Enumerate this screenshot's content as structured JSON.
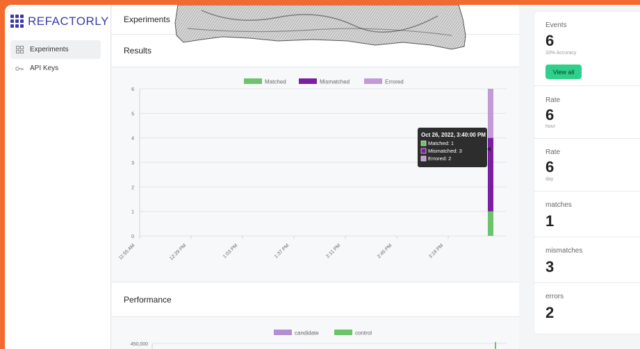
{
  "brand": {
    "name": "REFACTORLY"
  },
  "sidebar": {
    "items": [
      {
        "label": "Experiments",
        "icon": "grid-icon",
        "active": true
      },
      {
        "label": "API Keys",
        "icon": "key-icon",
        "active": false
      }
    ]
  },
  "header": {
    "title": "Experiments"
  },
  "results": {
    "title": "Results"
  },
  "performance": {
    "title": "Performance"
  },
  "stats": {
    "events_label": "Events",
    "events_value": "6",
    "events_sub": "33% Accuracy",
    "view_all_label": "View all",
    "rate_hour_label": "Rate",
    "rate_hour_value": "6",
    "rate_hour_sub": "hour",
    "rate_day_label": "Rate",
    "rate_day_value": "6",
    "rate_day_sub": "day",
    "matches_label": "matches",
    "matches_value": "1",
    "mismatches_label": "mismatches",
    "mismatches_value": "3",
    "errors_label": "errors",
    "errors_value": "2"
  },
  "colors": {
    "accent": "#2fd08b",
    "brand": "#3b3aa8",
    "background": "#f26a2e"
  },
  "chart_data": [
    {
      "type": "bar",
      "stacked": true,
      "title": "Results",
      "legend_position": "top",
      "ylim": [
        0,
        6
      ],
      "yticks": [
        "0",
        "1",
        "2",
        "3",
        "4",
        "5",
        "6"
      ],
      "xticks": [
        "11:55 AM",
        "12:29 PM",
        "1:03 PM",
        "1:37 PM",
        "2:11 PM",
        "2:45 PM",
        "3:19 PM"
      ],
      "series": [
        {
          "name": "Matched",
          "color": "#6cc36c",
          "values": [
            1
          ]
        },
        {
          "name": "Mismatched",
          "color": "#7a1fa2",
          "values": [
            3
          ]
        },
        {
          "name": "Errored",
          "color": "#c29ad6",
          "values": [
            2
          ]
        }
      ],
      "tooltip": {
        "title": "Oct 26, 2022, 3:40:00 PM",
        "lines": [
          "Matched: 1",
          "Mismatched: 3",
          "Errored: 2"
        ]
      }
    },
    {
      "type": "line",
      "title": "Performance",
      "legend_position": "top",
      "series": [
        {
          "name": "candidate",
          "color": "#b48ed0"
        },
        {
          "name": "control",
          "color": "#6cc36c"
        }
      ],
      "yticks": [
        "450,000"
      ]
    }
  ]
}
